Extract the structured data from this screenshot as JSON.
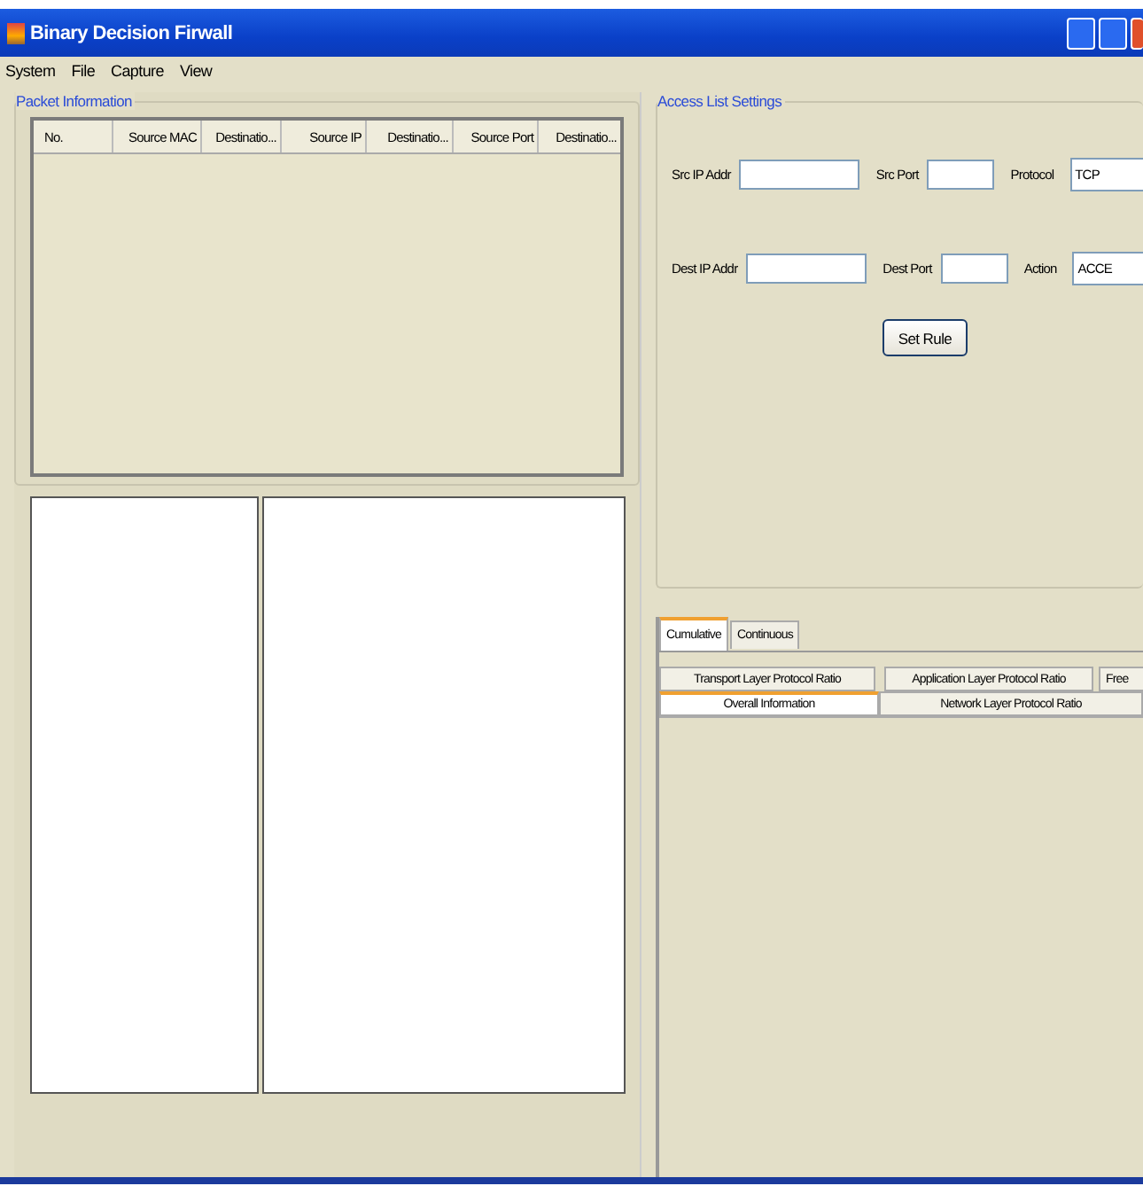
{
  "window": {
    "title": "Binary Decision Firwall"
  },
  "menu": [
    "System",
    "File",
    "Capture",
    "View"
  ],
  "packet_information": {
    "title": "Packet Information",
    "table": {
      "columns": [
        "No.",
        "Source MAC",
        "Destinatio...",
        "Source IP",
        "Destinatio...",
        "Source Port",
        "Destinatio..."
      ]
    }
  },
  "access_list_settings": {
    "title": "Access List Settings",
    "rows": [
      [
        {
          "label": "Src IP Addr",
          "kind": "field"
        },
        {
          "label": "Src Port",
          "kind": "field"
        },
        {
          "label": "Protocol",
          "kind": "combo",
          "value": "TCP"
        }
      ],
      [
        {
          "label": "Dest IP Addr",
          "kind": "field"
        },
        {
          "label": "Dest Port",
          "kind": "field"
        },
        {
          "label": "Action",
          "kind": "combo",
          "value": "ACCE"
        }
      ]
    ],
    "button": "Set Rule"
  },
  "mode_tabs": [
    {
      "label": "Cumulative",
      "selected": true
    },
    {
      "label": "Continuous",
      "selected": false
    }
  ],
  "info_tabs": [
    [
      {
        "label": "Transport Layer Protocol Ratio",
        "selected": false
      },
      {
        "label": "Application Layer Protocol Ratio",
        "selected": false
      },
      {
        "label": "Free",
        "selected": false
      }
    ],
    [
      {
        "label": "Overall Information",
        "selected": true
      },
      {
        "label": "Network Layer Protocol Ratio",
        "selected": false
      }
    ]
  ]
}
